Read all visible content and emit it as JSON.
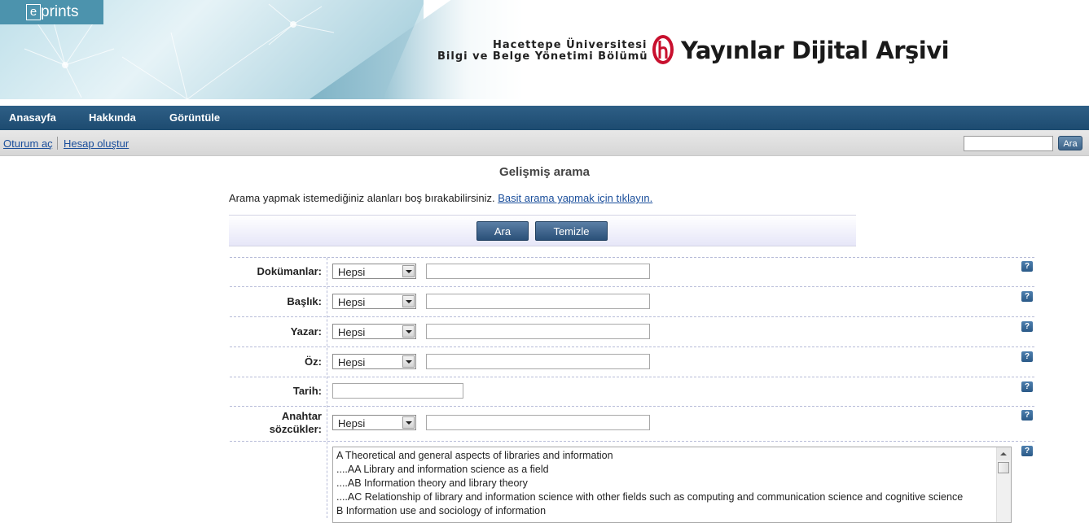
{
  "brand": {
    "eprints_e": "e",
    "eprints_rest": "prints",
    "university_line1": "Hacettepe Üniversitesi",
    "university_line2": "Bilgi ve Belge Yönetimi Bölümü",
    "archive_title": "Yayınlar Dijital Arşivi"
  },
  "nav": [
    "Anasayfa",
    "Hakkında",
    "Görüntüle"
  ],
  "userbar": {
    "login": "Oturum aç",
    "register": "Hesap oluştur",
    "search_button": "Ara",
    "search_value": ""
  },
  "page": {
    "title": "Gelişmiş arama",
    "intro_text": "Arama yapmak istemediğiniz alanları boş bırakabilirsiniz.",
    "intro_link": "Basit arama yapmak için tıklayın.",
    "search_button": "Ara",
    "clear_button": "Temizle"
  },
  "fields": [
    {
      "label": "Dokümanlar:",
      "select": "Hepsi",
      "value": ""
    },
    {
      "label": "Başlık:",
      "select": "Hepsi",
      "value": ""
    },
    {
      "label": "Yazar:",
      "select": "Hepsi",
      "value": ""
    },
    {
      "label": "Öz:",
      "select": "Hepsi",
      "value": ""
    },
    {
      "label": "Tarih:",
      "value": ""
    },
    {
      "label_line1": "Anahtar",
      "label_line2": "sözcükler:",
      "select": "Hepsi",
      "value": ""
    }
  ],
  "help_label": "?",
  "subjects": [
    "A Theoretical and general aspects of libraries and information",
    "....AA Library and information science as a field",
    "....AB Information theory and library theory",
    "....AC Relationship of library and information science with other fields such as computing and communication science and cognitive science",
    "B Information use and sociology of information"
  ]
}
